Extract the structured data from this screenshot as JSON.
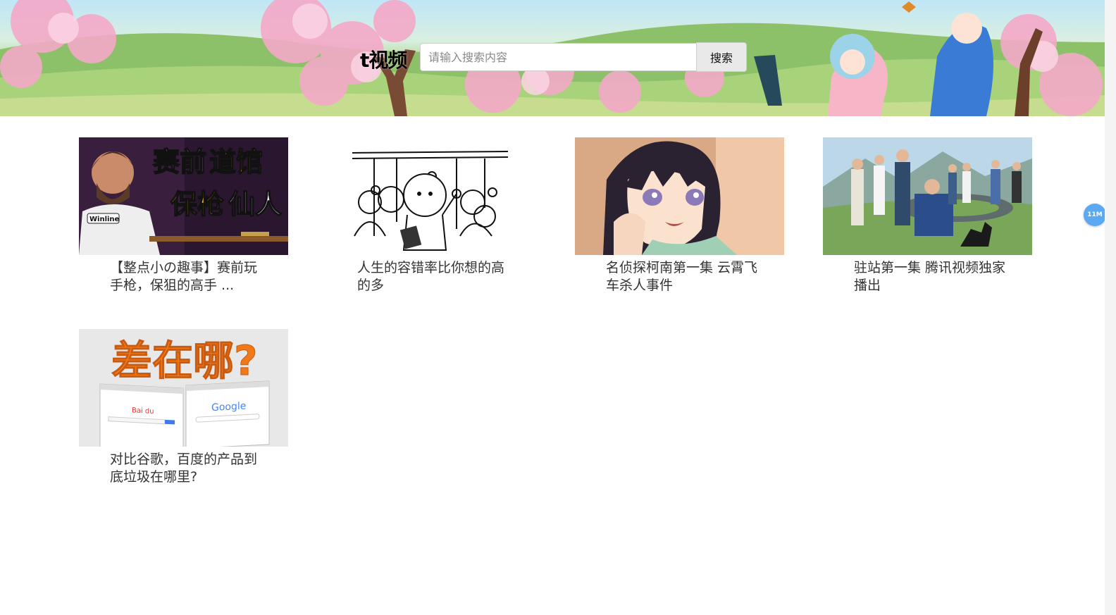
{
  "header": {
    "brand": "t视频",
    "search_placeholder": "请输入搜索内容",
    "search_button": "搜索"
  },
  "videos": [
    {
      "title": "【整点小の趣事】赛前玩手枪，保狙的高手 ...",
      "thumb_text_line1_a": "赛前",
      "thumb_text_line1_b": "道馆",
      "thumb_text_line2_a": "保枪",
      "thumb_text_line2_b": "仙人",
      "thumb_jersey_text": "Winline"
    },
    {
      "title": "人生的容错率比你想的高的多"
    },
    {
      "title": "名侦探柯南第一集 云霄飞车杀人事件"
    },
    {
      "title": "驻站第一集 腾讯视频独家播出"
    },
    {
      "title": "对比谷歌，百度的产品到底垃圾在哪里?",
      "thumb_text": "差在哪?",
      "thumb_left_logo": "Bai du",
      "thumb_right_logo": "Google"
    }
  ],
  "floating_badge": "11M",
  "colors": {
    "accent_badge": "#5aa9f2",
    "title_yellow": "#f5c518",
    "title_orange": "#f07a1a"
  }
}
